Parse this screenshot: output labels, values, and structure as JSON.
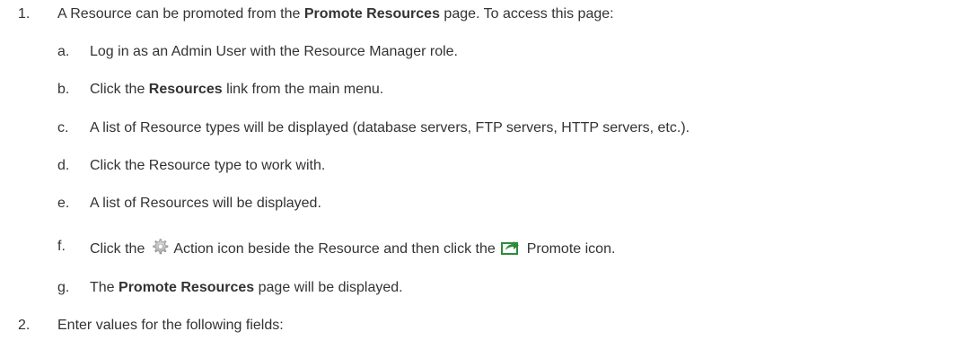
{
  "steps": [
    {
      "number": "1.",
      "text_before": "A Resource can be promoted from the ",
      "bold": "Promote Resources",
      "text_after": " page. To access this page:",
      "substeps": [
        {
          "letter": "a.",
          "text": "Log in as an Admin User with the Resource Manager role."
        },
        {
          "letter": "b.",
          "text_before": "Click the ",
          "bold": "Resources",
          "text_after": " link from the main menu."
        },
        {
          "letter": "c.",
          "text": "A list of Resource types will be displayed (database servers, FTP servers, HTTP servers, etc.)."
        },
        {
          "letter": "d.",
          "text": "Click the Resource type to work with."
        },
        {
          "letter": "e.",
          "text": "A list of Resources will be displayed."
        },
        {
          "letter": "f.",
          "text_before": "Click the ",
          "icon1": "gear-icon",
          "text_middle": " Action icon beside the Resource and then click the ",
          "icon2": "promote-icon",
          "text_after": " Promote icon."
        },
        {
          "letter": "g.",
          "text_before": "The ",
          "bold": "Promote Resources",
          "text_after": " page will be displayed."
        }
      ]
    },
    {
      "number": "2.",
      "text": "Enter values for the following fields:"
    }
  ]
}
